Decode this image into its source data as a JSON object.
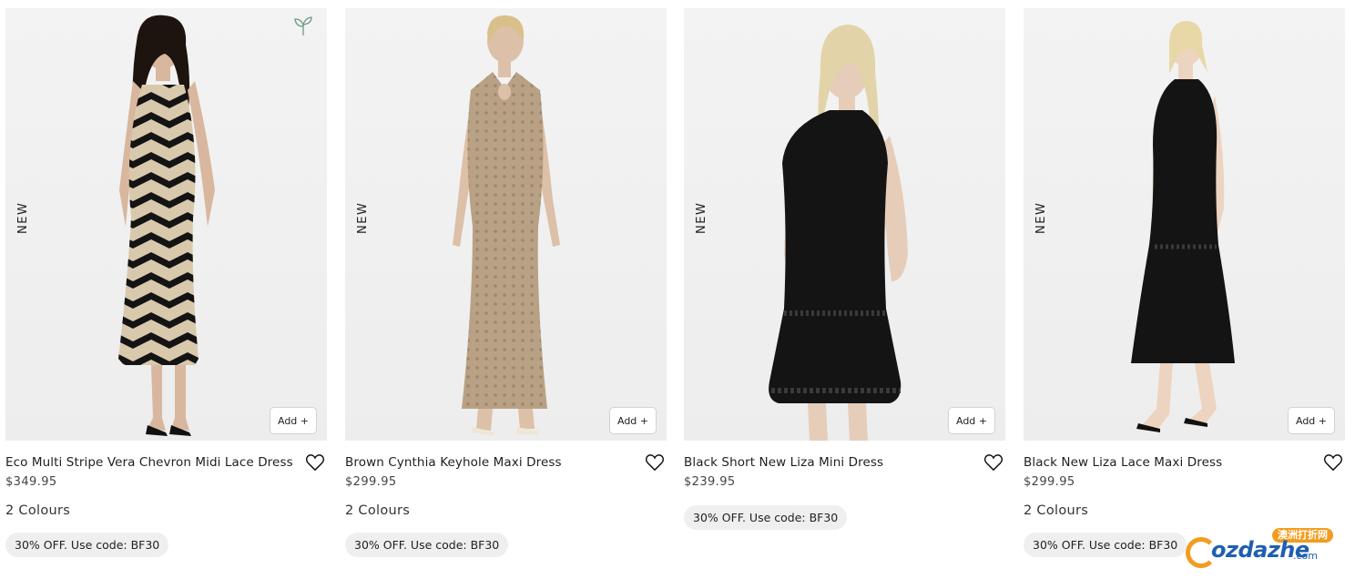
{
  "products": [
    {
      "title": "Eco Multi Stripe Vera Chevron Midi Lace Dress",
      "price": "$349.95",
      "colours": "2 Colours",
      "badge": "NEW",
      "eco": true,
      "add_label": "Add +",
      "promo": "30% OFF. Use code: BF30",
      "dress_color": "#1c1c1c"
    },
    {
      "title": "Brown Cynthia Keyhole Maxi Dress",
      "price": "$299.95",
      "colours": "2 Colours",
      "badge": "NEW",
      "eco": false,
      "add_label": "Add +",
      "promo": "30% OFF. Use code: BF30",
      "dress_color": "#b49d7f"
    },
    {
      "title": "Black Short New Liza Mini Dress",
      "price": "$239.95",
      "colours": "",
      "badge": "NEW",
      "eco": false,
      "add_label": "Add +",
      "promo": "30% OFF. Use code: BF30",
      "dress_color": "#141414"
    },
    {
      "title": "Black New Liza Lace Maxi Dress",
      "price": "$299.95",
      "colours": "2 Colours",
      "badge": "NEW",
      "eco": false,
      "add_label": "Add +",
      "promo": "30% OFF. Use code: BF30",
      "dress_color": "#141414"
    }
  ],
  "watermark": {
    "tag": "澳洲打折网",
    "brand": "ozdazhe",
    "domain": ".com"
  },
  "icons": {
    "heart": "heart-icon",
    "eco": "leaf-icon"
  }
}
